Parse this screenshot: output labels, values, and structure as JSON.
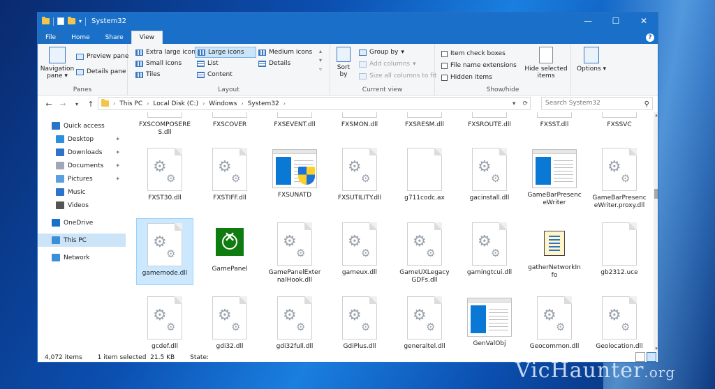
{
  "window": {
    "title": "System32",
    "controls": [
      "—",
      "☐",
      "✕"
    ]
  },
  "ribbon_tabs": [
    "File",
    "Home",
    "Share",
    "View"
  ],
  "ribbon": {
    "panes": {
      "navigation_pane": "Navigation pane",
      "preview_pane": "Preview pane",
      "details_pane": "Details pane",
      "label": "Panes"
    },
    "layout": {
      "items": [
        "Extra large icons",
        "Large icons",
        "Medium icons",
        "Small icons",
        "List",
        "Details",
        "Tiles",
        "Content"
      ],
      "selected": "Large icons",
      "label": "Layout"
    },
    "current_view": {
      "sort_by": "Sort by",
      "group_by": "Group by",
      "add_columns": "Add columns",
      "size_all_columns": "Size all columns to fit",
      "label": "Current view"
    },
    "show_hide": {
      "item_check_boxes": "Item check boxes",
      "file_name_extensions": "File name extensions",
      "hidden_items": "Hidden items",
      "hide_selected_items": "Hide selected items",
      "label": "Show/hide"
    },
    "options": "Options"
  },
  "address": {
    "breadcrumb": [
      "This PC",
      "Local Disk (C:)",
      "Windows",
      "System32"
    ],
    "search_placeholder": "Search System32"
  },
  "nav": [
    {
      "label": "Quick access",
      "icon": "star-icon",
      "level": 0,
      "pinned": false
    },
    {
      "label": "Desktop",
      "icon": "desktop-icon",
      "level": 1,
      "pinned": true
    },
    {
      "label": "Downloads",
      "icon": "download-icon",
      "level": 1,
      "pinned": true
    },
    {
      "label": "Documents",
      "icon": "document-icon",
      "level": 1,
      "pinned": true
    },
    {
      "label": "Pictures",
      "icon": "picture-icon",
      "level": 1,
      "pinned": true
    },
    {
      "label": "Music",
      "icon": "music-icon",
      "level": 1,
      "pinned": false
    },
    {
      "label": "Videos",
      "icon": "video-icon",
      "level": 1,
      "pinned": false
    },
    {
      "label": "OneDrive",
      "icon": "cloud-icon",
      "level": 0,
      "pinned": false
    },
    {
      "label": "This PC",
      "icon": "computer-icon",
      "level": 0,
      "pinned": false,
      "selected": true
    },
    {
      "label": "Network",
      "icon": "network-icon",
      "level": 0,
      "pinned": false
    }
  ],
  "files": [
    {
      "name": "FXSCOMPOSERES.dll",
      "icon": "gear"
    },
    {
      "name": "FXSCOVER",
      "icon": "gear"
    },
    {
      "name": "FXSEVENT.dll",
      "icon": "gear"
    },
    {
      "name": "FXSMON.dll",
      "icon": "gear"
    },
    {
      "name": "FXSRESM.dll",
      "icon": "gear"
    },
    {
      "name": "FXSROUTE.dll",
      "icon": "gear"
    },
    {
      "name": "FXSST.dll",
      "icon": "gear"
    },
    {
      "name": "FXSSVC",
      "icon": "gear"
    },
    {
      "name": "FXST30.dll",
      "icon": "gear"
    },
    {
      "name": "FXSTIFF.dll",
      "icon": "gear"
    },
    {
      "name": "FXSUNATD",
      "icon": "shield-app"
    },
    {
      "name": "FXSUTILITY.dll",
      "icon": "gear"
    },
    {
      "name": "g711codc.ax",
      "icon": "blank"
    },
    {
      "name": "gacinstall.dll",
      "icon": "gear"
    },
    {
      "name": "GameBarPresenceWriter",
      "icon": "app"
    },
    {
      "name": "GameBarPresenceWriter.proxy.dll",
      "icon": "gear"
    },
    {
      "name": "gamemode.dll",
      "icon": "gear",
      "selected": true
    },
    {
      "name": "GamePanel",
      "icon": "xbox"
    },
    {
      "name": "GamePanelExternalHook.dll",
      "icon": "gear"
    },
    {
      "name": "gameux.dll",
      "icon": "gear"
    },
    {
      "name": "GameUXLegacyGDFs.dll",
      "icon": "gear"
    },
    {
      "name": "gamingtcui.dll",
      "icon": "gear"
    },
    {
      "name": "gatherNetworkInfo",
      "icon": "script"
    },
    {
      "name": "gb2312.uce",
      "icon": "blank"
    },
    {
      "name": "gcdef.dll",
      "icon": "gear"
    },
    {
      "name": "gdi32.dll",
      "icon": "gear"
    },
    {
      "name": "gdi32full.dll",
      "icon": "gear"
    },
    {
      "name": "GdiPlus.dll",
      "icon": "gear"
    },
    {
      "name": "generaltel.dll",
      "icon": "gear"
    },
    {
      "name": "GenValObj",
      "icon": "app"
    },
    {
      "name": "Geocommon.dll",
      "icon": "gear"
    },
    {
      "name": "Geolocation.dll",
      "icon": "gear"
    }
  ],
  "status": {
    "items_count": "4,072 items",
    "selected": "1 item selected",
    "size": "21.5 KB",
    "state": "State:"
  },
  "watermark": {
    "main": "VicHaunter",
    "tld": ".org"
  },
  "colors": {
    "titlebar": "#1a70c8",
    "selection": "#cce8ff",
    "accent": "#0a79d5"
  }
}
